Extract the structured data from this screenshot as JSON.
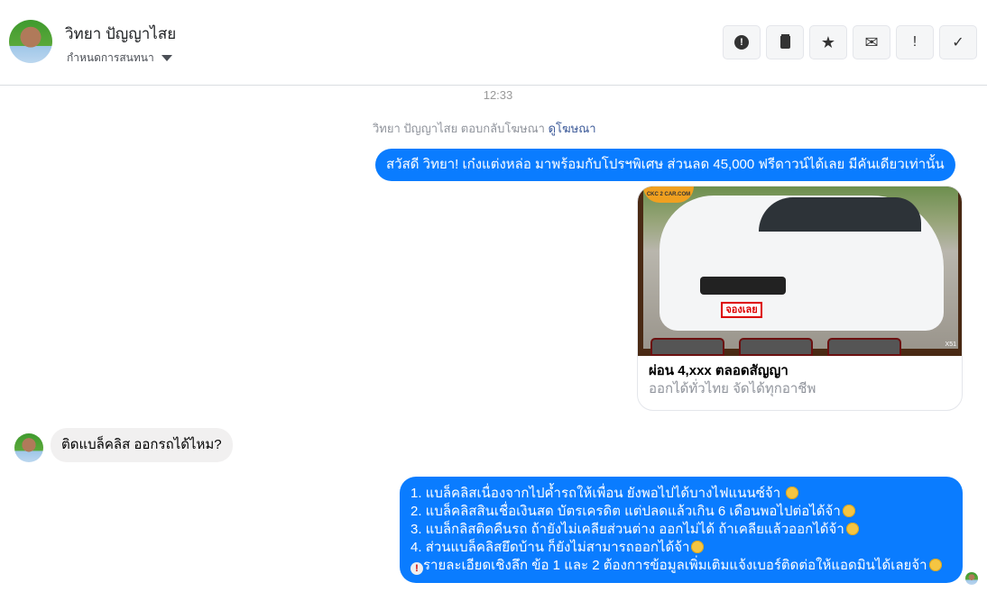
{
  "header": {
    "contact_name": "วิทยา ปัญญาไสย",
    "subtitle": "กำหนดการสนทนา",
    "buttons": [
      {
        "icon": "alert-circle-icon",
        "glyph": "!"
      },
      {
        "icon": "trash-icon",
        "glyph": "🗑"
      },
      {
        "icon": "star-icon",
        "glyph": "★"
      },
      {
        "icon": "envelope-icon",
        "glyph": "✉"
      },
      {
        "icon": "exclamation-icon",
        "glyph": "!"
      },
      {
        "icon": "check-icon",
        "glyph": "✓"
      }
    ]
  },
  "conversation": {
    "timestamp": "12:33",
    "notice_text": "วิทยา ปัญญาไสย ตอบกลับโฆษณา",
    "notice_link": "ดูโฆษณา",
    "messages": {
      "ad_greeting": "สวัสดี วิทยา! เก๋งแต่งหล่อ มาพร้อมกับโปรฯพิเศษ ส่วนลด 45,000 ฟรีดาวน์ได้เลย มีคันเดียวเท่านั้น",
      "ad_card": {
        "image_logo": "CKC 2 CAR.COM",
        "image_plate": "จองเลย",
        "image_code": "X51",
        "title": "ผ่อน 4,xxx ตลอดสัญญา",
        "subtitle": "ออกได้ทั่วไทย จัดได้ทุกอาชีพ"
      },
      "incoming": "ติดแบล็คลิส ออกรถได้ไหม?",
      "reply_lines": [
        "1. แบล็คลิสเนื่องจากไปค้ำรถให้เพื่อน ยังพอไปได้บางไฟแนนซ์จ้า",
        "2. แบล็คลิสสินเชื่อเงินสด บัตรเครดิต แต่ปลดแล้วเกิน 6 เดือนพอไปต่อได้จ้า",
        "3. แบล็กลิสติดคืนรถ ถ้ายังไม่เคลียส่วนต่าง ออกไม่ได้ ถ้าเคลียแล้วออกได้จ้า",
        "4. ส่วนแบล็คลิสยึดบ้าน ก็ยังไม่สามารถออกได้จ้า",
        "รายละเอียดเชิงลึก ข้อ 1 และ 2 ต้องการข้อมูลเพิ่มเติมแจ้งเบอร์ติดต่อให้แอดมินได้เลยจ้า"
      ]
    }
  }
}
